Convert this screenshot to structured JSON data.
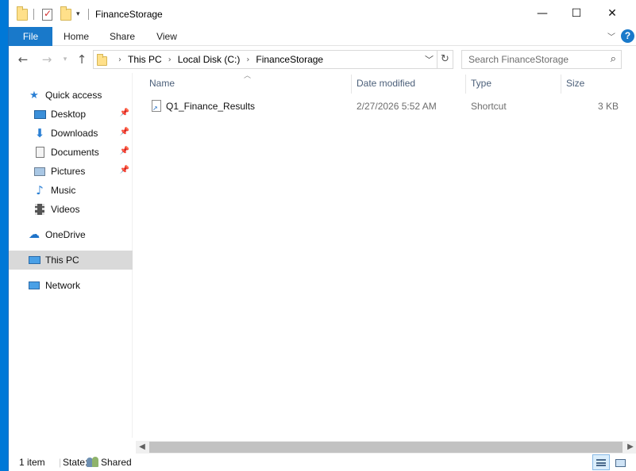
{
  "window": {
    "title": "FinanceStorage",
    "controls": {
      "minimize": "—",
      "maximize": "☐",
      "close": "✕"
    }
  },
  "ribbon": {
    "tabs": [
      "File",
      "Home",
      "Share",
      "View"
    ],
    "help": "?"
  },
  "address": {
    "breadcrumb": [
      "This PC",
      "Local Disk (C:)",
      "FinanceStorage"
    ]
  },
  "search": {
    "placeholder": "Search FinanceStorage"
  },
  "nav": {
    "quick_access": "Quick access",
    "items": [
      {
        "label": "Desktop",
        "icon": "desktop-icon",
        "pinned": true
      },
      {
        "label": "Downloads",
        "icon": "download-icon",
        "pinned": true
      },
      {
        "label": "Documents",
        "icon": "documents-icon",
        "pinned": true
      },
      {
        "label": "Pictures",
        "icon": "pictures-icon",
        "pinned": true
      },
      {
        "label": "Music",
        "icon": "music-icon",
        "pinned": false
      },
      {
        "label": "Videos",
        "icon": "videos-icon",
        "pinned": false
      }
    ],
    "onedrive": "OneDrive",
    "this_pc": "This PC",
    "network": "Network"
  },
  "columns": [
    "Name",
    "Date modified",
    "Type",
    "Size"
  ],
  "files": [
    {
      "name": "Q1_Finance_Results",
      "date": "2/27/2026 5:52 AM",
      "type": "Shortcut",
      "size": "3 KB"
    }
  ],
  "status": {
    "count": "1 item",
    "state_label": "State:",
    "state_value": "Shared"
  },
  "colors": {
    "accent": "#1979ca",
    "desktop": "#0078d7",
    "selection": "#d9d9d9"
  }
}
